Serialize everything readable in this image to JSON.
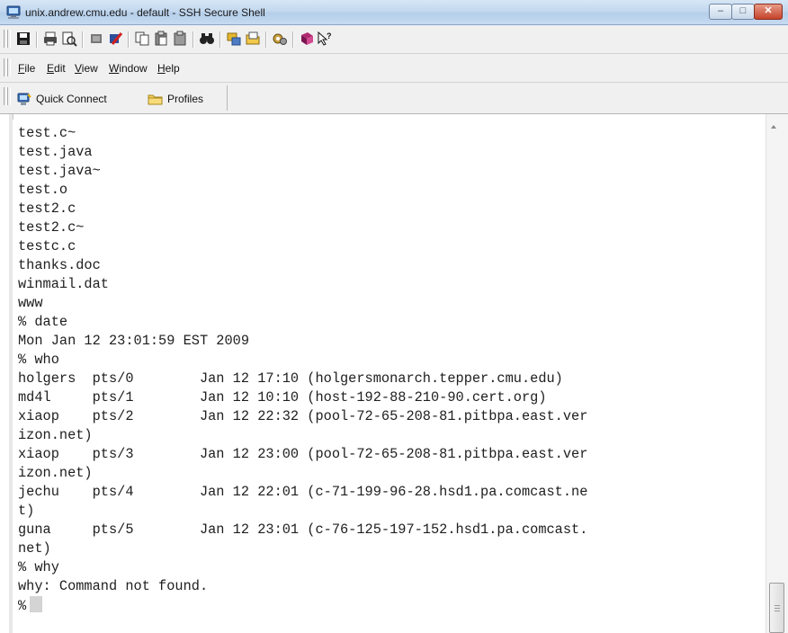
{
  "window": {
    "title": "unix.andrew.cmu.edu - default - SSH Secure Shell",
    "controls": {
      "minimize": "–",
      "maximize": "□",
      "close": "✕"
    }
  },
  "toolbar": {
    "buttons": [
      "save-icon",
      "print-icon",
      "print-preview-icon",
      "disconnect-icon",
      "connect-icon",
      "copy-icon",
      "paste-icon",
      "paste-alt-icon",
      "find-icon",
      "transfer-icon",
      "file-icon",
      "settings-icon",
      "help-book-icon",
      "context-help-icon"
    ]
  },
  "menu": {
    "items": [
      {
        "label": "File",
        "mnemonic": "F",
        "rest": "ile"
      },
      {
        "label": "Edit",
        "mnemonic": "E",
        "rest": "dit"
      },
      {
        "label": "View",
        "mnemonic": "V",
        "rest": "iew"
      },
      {
        "label": "Window",
        "mnemonic": "W",
        "rest": "indow"
      },
      {
        "label": "Help",
        "mnemonic": "H",
        "rest": "elp"
      }
    ]
  },
  "quickbar": {
    "quick_connect": "Quick Connect",
    "profiles": "Profiles"
  },
  "terminal": {
    "lines": [
      "test.c~",
      "test.java",
      "test.java~",
      "test.o",
      "test2.c",
      "test2.c~",
      "testc.c",
      "thanks.doc",
      "winmail.dat",
      "www",
      "% date",
      "Mon Jan 12 23:01:59 EST 2009",
      "% who",
      "holgers  pts/0        Jan 12 17:10 (holgersmonarch.tepper.cmu.edu)",
      "md4l     pts/1        Jan 12 10:10 (host-192-88-210-90.cert.org)",
      "xiaop    pts/2        Jan 12 22:32 (pool-72-65-208-81.pitbpa.east.ver",
      "izon.net)",
      "xiaop    pts/3        Jan 12 23:00 (pool-72-65-208-81.pitbpa.east.ver",
      "izon.net)",
      "jechu    pts/4        Jan 12 22:01 (c-71-199-96-28.hsd1.pa.comcast.ne",
      "t)",
      "guna     pts/5        Jan 12 23:01 (c-76-125-197-152.hsd1.pa.comcast.",
      "net)",
      "% why",
      "why: Command not found."
    ],
    "prompt": "%"
  }
}
